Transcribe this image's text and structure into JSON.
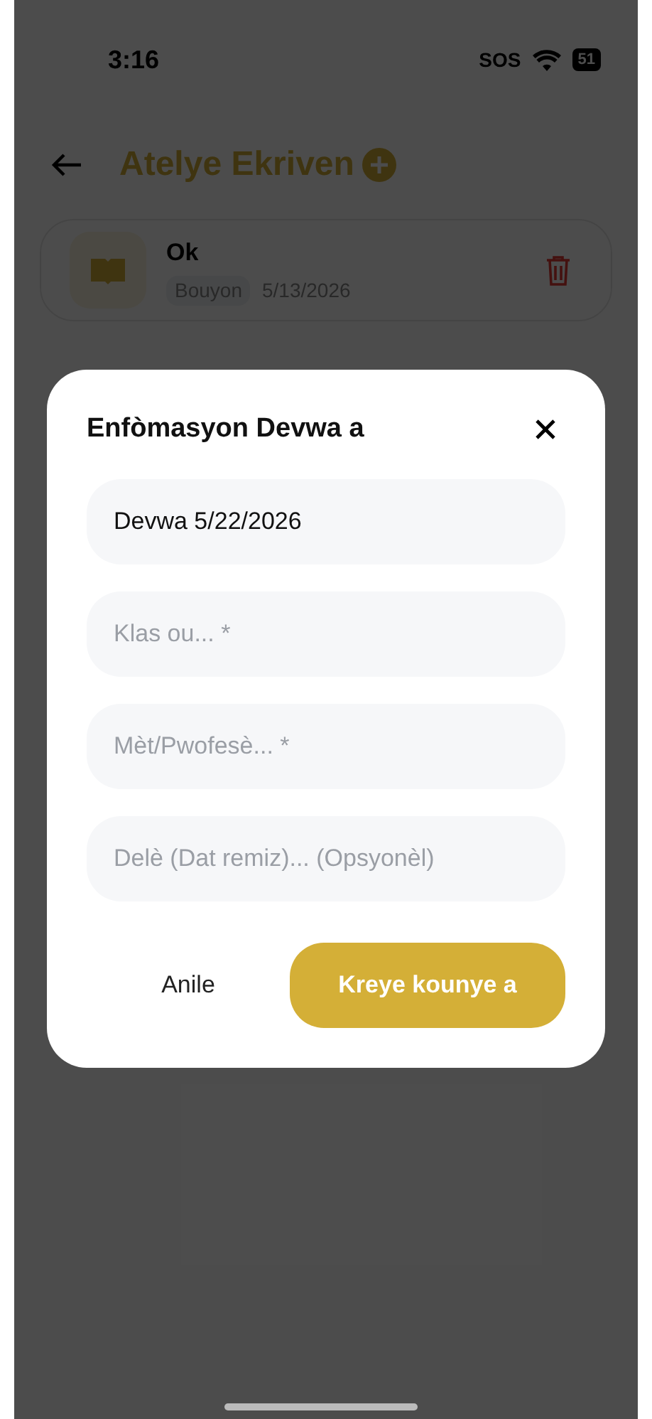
{
  "status_bar": {
    "time": "3:16",
    "sos": "SOS",
    "battery": "51"
  },
  "header": {
    "title": "Atelye Ekriven"
  },
  "items": [
    {
      "title": "Ok",
      "tag": "Bouyon",
      "date": "5/13/2026"
    }
  ],
  "dialog": {
    "title": "Enfòmasyon Devwa a",
    "fields": [
      {
        "value": "Devwa 5/22/2026"
      },
      {
        "placeholder": "Klas ou... *"
      },
      {
        "placeholder": "Mèt/Pwofesè... *"
      },
      {
        "placeholder": "Delè (Dat remiz)... (Opsyonèl)"
      }
    ],
    "cancel": "Anile",
    "confirm": "Kreye kounye a"
  }
}
